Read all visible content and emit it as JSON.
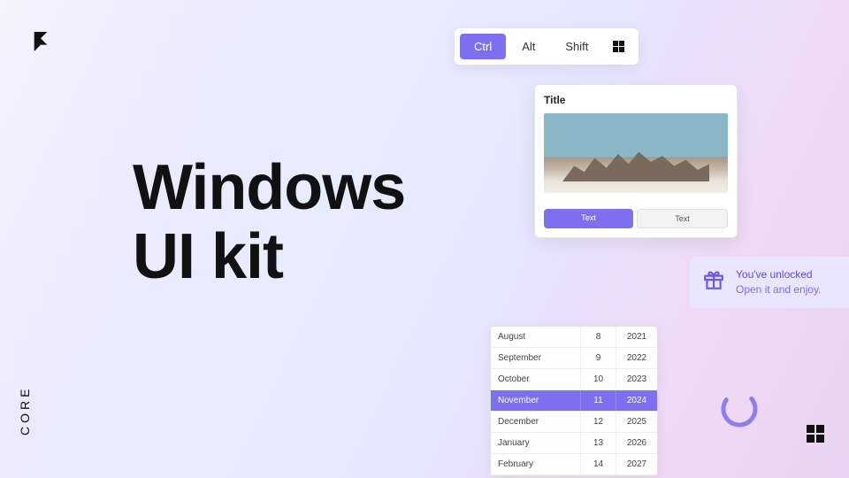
{
  "logo": "F",
  "headline": {
    "line1": "Windows",
    "line2": "UI kit"
  },
  "core": "CORE",
  "toolbar": {
    "ctrl": "Ctrl",
    "alt": "Alt",
    "shift": "Shift"
  },
  "card": {
    "title": "Title",
    "primary": "Text",
    "secondary": "Text"
  },
  "toast": {
    "title": "You've unlocked",
    "sub": "Open it and enjoy."
  },
  "datepicker": {
    "rows": [
      {
        "month": "August",
        "day": "8",
        "year": "2021"
      },
      {
        "month": "September",
        "day": "9",
        "year": "2022"
      },
      {
        "month": "October",
        "day": "10",
        "year": "2023"
      },
      {
        "month": "November",
        "day": "11",
        "year": "2024"
      },
      {
        "month": "December",
        "day": "12",
        "year": "2025"
      },
      {
        "month": "January",
        "day": "13",
        "year": "2026"
      },
      {
        "month": "February",
        "day": "14",
        "year": "2027"
      }
    ],
    "selected_index": 3
  },
  "colors": {
    "accent": "#7c6ff0"
  }
}
